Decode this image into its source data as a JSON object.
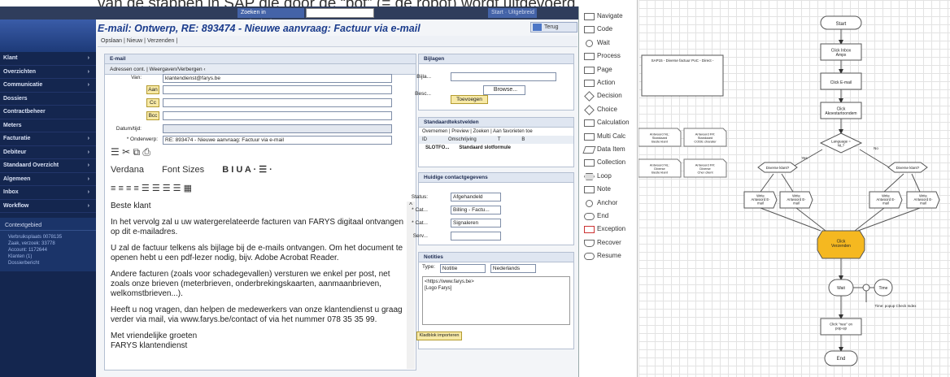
{
  "caption": "van de stappen in SAP die door de “bot” (= de robot) wordt uitgevoerd.",
  "crm": {
    "search": {
      "label": "Zoeken in zoekopdrachten",
      "button": "Start · Uitgebreid"
    },
    "email_title": "E-mail: Ontwerp, RE: 893474 - Nieuwe aanvraag: Factuur via e-mail",
    "nav_label": "Terug",
    "toolbar": "Opslaan  |  Nieuw  |  Verzenden  |",
    "sidebar": [
      {
        "label": "Klant",
        "arrow": true
      },
      {
        "label": "Overzichten",
        "arrow": true
      },
      {
        "label": "Communicatie",
        "arrow": true
      },
      {
        "label": "Dossiers",
        "arrow": false
      },
      {
        "label": "Contractbeheer",
        "arrow": false
      },
      {
        "label": "Meters",
        "arrow": false
      },
      {
        "label": "Facturatie",
        "arrow": true
      },
      {
        "label": "Debiteur",
        "arrow": true
      },
      {
        "label": "Standaard Overzicht",
        "arrow": true
      },
      {
        "label": "Algemeen",
        "arrow": true
      },
      {
        "label": "Inbox",
        "arrow": true
      },
      {
        "label": "Workflow",
        "arrow": true
      }
    ],
    "context": {
      "title": "Contextgebied",
      "items": [
        "Verbruiksplaats 0078135",
        "Zaak, verzoek: 33778",
        "Account: 1172644",
        "Klanten (1)",
        "Dossierbericht"
      ]
    },
    "email": {
      "panel_title": "E-mail",
      "tabs": "Adressen cont.  |  Weergaven/Verbergen ‹",
      "from_label": "Van:",
      "from_value": "klantendienst@farys.be",
      "to_btn": "Aan",
      "cc_btn": "Cc",
      "bcc_btn": "Bcc",
      "date_label": "Datum/tijd:",
      "subject_label": "* Onderwerp:",
      "subject_value": "RE: 893474 - Nieuwe aanvraag: Factuur via e-mail",
      "tools1": "☰   ✂   ⧉   ⎙",
      "font_name": "Verdana",
      "font_size": "Font Sizes",
      "format": "B   I   U   A ·   ☰ ·",
      "tools3": "≡   ≡   ≡   ≡   ☰   ☰   ☰   ☰   ▦",
      "body": [
        "Beste klant",
        "In het vervolg zal u uw watergerelateerde facturen van FARYS digitaal ontvangen op dit e-mailadres.",
        "U zal de factuur telkens als bijlage bij de e-mails ontvangen. Om het document te openen hebt u een pdf-lezer nodig, bijv. Adobe Acrobat Reader.",
        "Andere facturen (zoals voor schadegevallen) versturen we enkel per post, net zoals onze brieven (meterbrieven, onderbrekingskaarten, aanmaanbrieven, welkomstbrieven...).",
        "Heeft u nog vragen, dan helpen de medewerkers van onze klantendienst u graag verder via mail, via www.farys.be/contact of via het nummer 078 35 35 99.",
        "Met vriendelijke groeten",
        "FARYS klantendienst"
      ]
    },
    "attachments": {
      "title": "Bijlagen",
      "file_label": "Bijla...",
      "browse": "Browse...",
      "desc_label": "Besc...",
      "add_btn": "Toevoegen"
    },
    "standard_texts": {
      "title": "Standaardtekstvelden",
      "tabs": "Overnemen  |  Preview  |  Zoeken  |  Aan favorieten toe",
      "col_id": "ID",
      "col_desc": "Omschrijving",
      "col_t": "T",
      "col_b": "B",
      "row_id": "SLOTFO...",
      "row_desc": "Standaard slotformule"
    },
    "contact": {
      "title": "Huidige contactgegevens",
      "status_label": "Status:",
      "status_value": "Afgehandeld",
      "cat1_label": "* Cat...",
      "cat1_value": "Billing - Factu...",
      "cat2_label": "* Cat...",
      "cat2_value": "Signaleren",
      "serv_label": "Serv..."
    },
    "notes": {
      "title": "Notities",
      "type_label": "Type:",
      "type_value": "Notitie",
      "lang_value": "Nederlands",
      "text1": "<https://www.farys.be>",
      "text2": "[Logo Farys]",
      "import_btn": "Kladblok importeren"
    }
  },
  "palette": [
    "Navigate",
    "Code",
    "Wait",
    "Process",
    "Page",
    "Action",
    "Decision",
    "Choice",
    "Calculation",
    "Multi Calc",
    "Data Item",
    "Collection",
    "Loop",
    "Note",
    "Anchor",
    "End",
    "Exception",
    "Recover",
    "Resume"
  ],
  "flow": {
    "start": "Start",
    "step1": "Click Inbox\nAmpx",
    "step2": "Click E-mail",
    "step3": "Click\nAkoestartoondem",
    "decision": "Language =\nNL?",
    "desc_block": "SAP15 - Diverse factuur PoC - Direct -",
    "notes": [
      "Antwoord NL:\nStandaard\nBeste klant",
      "Antwoord FR:\nStandaard\nCODE charater",
      "Antwoord NL:\nDiverse\nBeste klant",
      "Antwoord FR:\nDiverse\nCher client"
    ],
    "yes": "Yes",
    "no": "No",
    "choices": [
      "Diverse klant?",
      "Diverse klant?"
    ],
    "writes": [
      "Write\nAntwoord E-\nmail",
      "Write\nAntwoord E-\nmail",
      "Write\nAntwoord E-\nmail",
      "Write\nAntwoord E-\nmail"
    ],
    "highlight": "Click\nVerzenden",
    "wait": "Wait",
    "wait_note": "Time",
    "wait_label": "Time: popup Check Index",
    "click_popup": "Click \"nee\" on\npop-up",
    "end": "End",
    "colors": {
      "highlight": "#f5b820",
      "shape_stroke": "#555"
    }
  }
}
